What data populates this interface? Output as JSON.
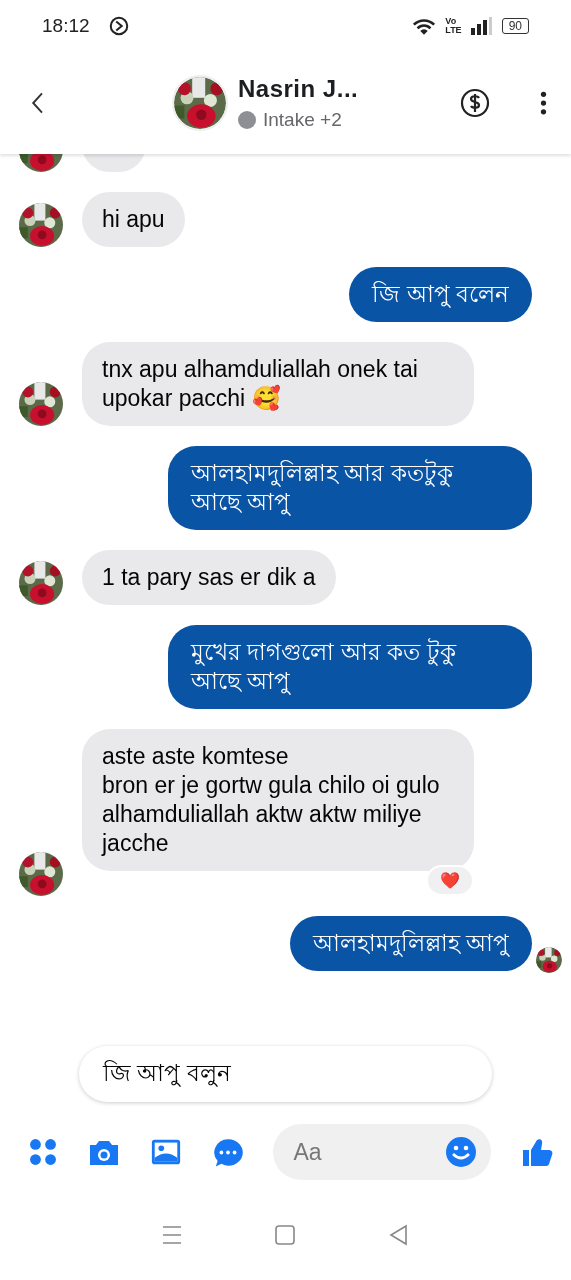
{
  "status_bar": {
    "time": "18:12",
    "network": [
      "Vo",
      "LTE"
    ],
    "battery": "90"
  },
  "header": {
    "name": "Nasrin J...",
    "subtitle": "Intake +2"
  },
  "messages": [
    {
      "kind": "cut"
    },
    {
      "kind": "incoming",
      "text": "hi apu"
    },
    {
      "kind": "outgoing",
      "text": "জি আপু বলেন"
    },
    {
      "kind": "incoming",
      "text": "tnx apu alhamduliallah onek tai upokar pacchi 🥰"
    },
    {
      "kind": "outgoing",
      "text": "আলহামদুলিল্লাহ আর কতটুকু আছে আপু"
    },
    {
      "kind": "incoming",
      "text": "1 ta pary sas er dik a"
    },
    {
      "kind": "outgoing",
      "text": "মুখের দাগগুলো আর কত টুকু আছে আপু"
    },
    {
      "kind": "incoming",
      "text": "aste aste komtese\nbron er je gortw gula chilo oi gulo alhamduliallah aktw aktw miliye jacche",
      "reaction": "❤️"
    },
    {
      "kind": "outgoing",
      "text": "আলহামদুলিল্লাহ আপু",
      "seen": true
    }
  ],
  "quick_reply": "জি আপু বলুন",
  "composer": {
    "placeholder": "Aa"
  }
}
